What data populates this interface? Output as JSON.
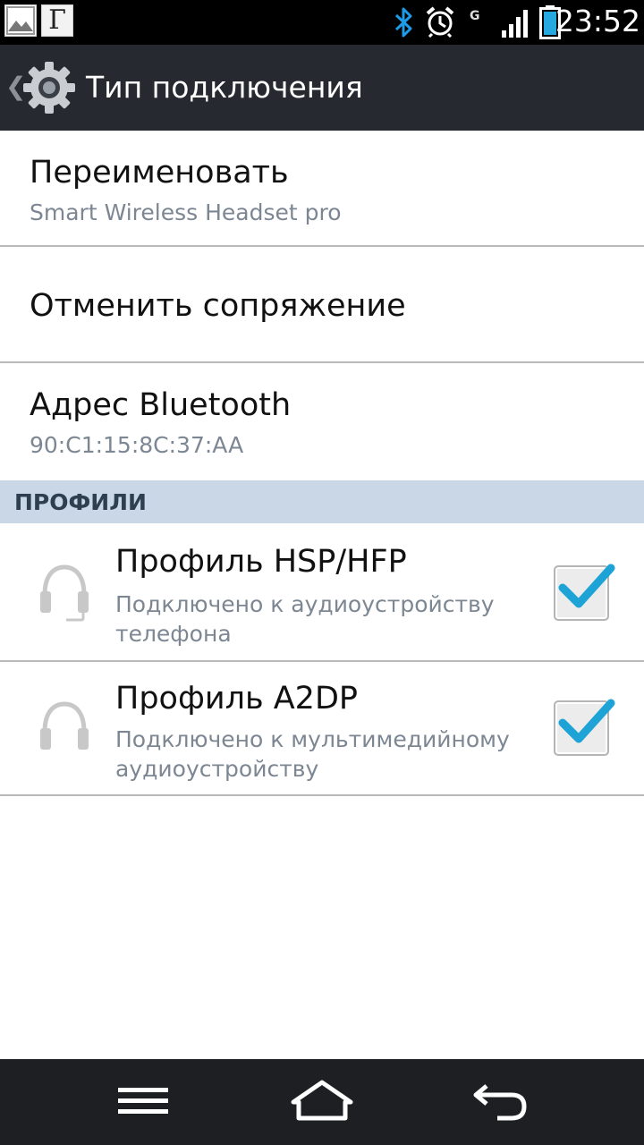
{
  "status_bar": {
    "time": "23:52",
    "network_label": "G",
    "notification_icons": [
      "image-icon",
      "g-app-icon"
    ],
    "app_letter": "Г",
    "battery_color": "#25a9e0",
    "bluetooth_color": "#1e9be6"
  },
  "action_bar": {
    "title": "Тип подключения",
    "background": "#262a30"
  },
  "items": [
    {
      "title": "Переименовать",
      "subtitle": "Smart Wireless Headset pro"
    },
    {
      "title": "Отменить сопряжение"
    },
    {
      "title": "Адрес Bluetooth",
      "subtitle": "90:C1:15:8C:37:AA"
    }
  ],
  "section": {
    "label": "ПРОФИЛИ",
    "background": "#c9d7e6"
  },
  "profiles": [
    {
      "title": "Профиль HSP/HFP",
      "subtitle": "Подключено к аудиоустройству телефона",
      "icon": "headset-mic-icon",
      "checked": true
    },
    {
      "title": "Профиль A2DP",
      "subtitle": "Подключено к мультимедийному аудиоустройству",
      "icon": "headphones-icon",
      "checked": true
    }
  ],
  "nav_bar": {
    "buttons": [
      "menu-icon",
      "home-icon",
      "back-icon"
    ]
  },
  "colors": {
    "check_accent": "#1ea3d6",
    "subtitle_text": "#7c8793"
  }
}
